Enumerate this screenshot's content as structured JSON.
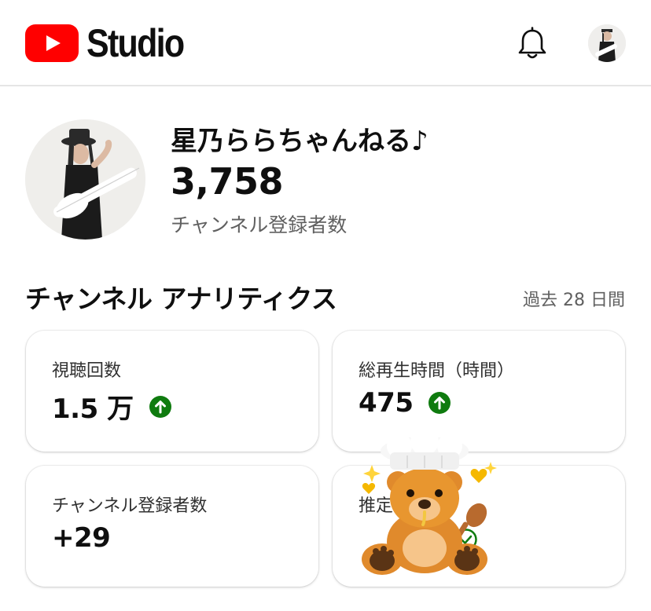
{
  "header": {
    "brand": "Studio",
    "icons": {
      "logo": "youtube-logo-icon",
      "notifications": "bell-icon",
      "account": "account-avatar"
    }
  },
  "channel": {
    "name": "星乃ららちゃんねる♪",
    "subscribers": "3,758",
    "subscribers_label": "チャンネル登録者数"
  },
  "analytics": {
    "title": "チャンネル アナリティクス",
    "period": "過去 28 日間",
    "cards": [
      {
        "label": "視聴回数",
        "value": "1.5 万",
        "trend": "up"
      },
      {
        "label": "総再生時間（時間）",
        "value": "475",
        "trend": "up"
      },
      {
        "label": "チャンネル登録者数",
        "value": "+29",
        "trend": "none"
      },
      {
        "label": "推定",
        "value": "",
        "trend": "up"
      }
    ]
  },
  "overlay": {
    "sticker": "chef-bear-sticker"
  },
  "colors": {
    "brand_red": "#ff0000",
    "trend_green": "#0f7b0f",
    "text_secondary": "#606060"
  }
}
